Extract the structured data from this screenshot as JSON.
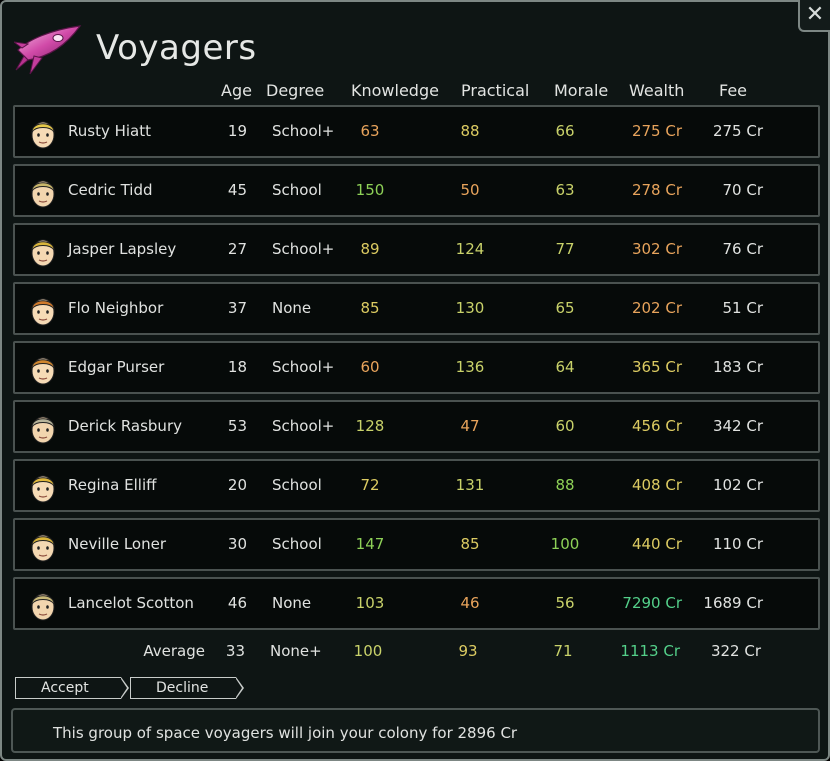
{
  "window": {
    "title": "Voyagers",
    "close_label": "✕"
  },
  "colors": {
    "text": "#e0e2e0",
    "bright_green": "#8ed157",
    "yellow_green": "#c9d26a",
    "yellow": "#dccb62",
    "orange": "#e8a45c",
    "teal_green": "#54d08a"
  },
  "columns": {
    "age": "Age",
    "degree": "Degree",
    "knowledge": "Knowledge",
    "practical": "Practical",
    "morale": "Morale",
    "wealth": "Wealth",
    "fee": "Fee"
  },
  "voyagers": [
    {
      "name": "Rusty Hiatt",
      "age": "19",
      "degree": "School+",
      "knowledge": "63",
      "practical": "88",
      "morale": "66",
      "wealth": "275 Cr",
      "fee": "275 Cr",
      "knowledge_color": "#e8a45c",
      "practical_color": "#dccb62",
      "morale_color": "#c9d26a",
      "wealth_color": "#e8a45c",
      "hair": "#e6c94a",
      "skin": "#f6dbb6"
    },
    {
      "name": "Cedric Tidd",
      "age": "45",
      "degree": "School",
      "knowledge": "150",
      "practical": "50",
      "morale": "63",
      "wealth": "278 Cr",
      "fee": "70 Cr",
      "knowledge_color": "#8ed157",
      "practical_color": "#e8a45c",
      "morale_color": "#c9d26a",
      "wealth_color": "#e8a45c",
      "hair": "#c8b66a",
      "skin": "#f2d5ae"
    },
    {
      "name": "Jasper Lapsley",
      "age": "27",
      "degree": "School+",
      "knowledge": "89",
      "practical": "124",
      "morale": "77",
      "wealth": "302 Cr",
      "fee": "76 Cr",
      "knowledge_color": "#dccb62",
      "practical_color": "#c9d26a",
      "morale_color": "#c9d26a",
      "wealth_color": "#e8a45c",
      "hair": "#d8b43a",
      "skin": "#f4d8b2"
    },
    {
      "name": "Flo Neighbor",
      "age": "37",
      "degree": "None",
      "knowledge": "85",
      "practical": "130",
      "morale": "65",
      "wealth": "202 Cr",
      "fee": "51 Cr",
      "knowledge_color": "#dccb62",
      "practical_color": "#c9d26a",
      "morale_color": "#c9d26a",
      "wealth_color": "#e8a45c",
      "hair": "#d07a2a",
      "skin": "#f6dbb6"
    },
    {
      "name": "Edgar Purser",
      "age": "18",
      "degree": "School+",
      "knowledge": "60",
      "practical": "136",
      "morale": "64",
      "wealth": "365 Cr",
      "fee": "183 Cr",
      "knowledge_color": "#e8a45c",
      "practical_color": "#c9d26a",
      "morale_color": "#c9d26a",
      "wealth_color": "#dccb62",
      "hair": "#d0862e",
      "skin": "#f6dbb6"
    },
    {
      "name": "Derick Rasbury",
      "age": "53",
      "degree": "School+",
      "knowledge": "128",
      "practical": "47",
      "morale": "60",
      "wealth": "456 Cr",
      "fee": "342 Cr",
      "knowledge_color": "#c9d26a",
      "practical_color": "#e8a45c",
      "morale_color": "#c9d26a",
      "wealth_color": "#dccb62",
      "hair": "#b8b49a",
      "skin": "#f2d5ae"
    },
    {
      "name": "Regina Elliff",
      "age": "20",
      "degree": "School",
      "knowledge": "72",
      "practical": "131",
      "morale": "88",
      "wealth": "408 Cr",
      "fee": "102 Cr",
      "knowledge_color": "#dccb62",
      "practical_color": "#c9d26a",
      "morale_color": "#8ed157",
      "wealth_color": "#dccb62",
      "hair": "#e0b83c",
      "skin": "#f6dbb6"
    },
    {
      "name": "Neville Loner",
      "age": "30",
      "degree": "School",
      "knowledge": "147",
      "practical": "85",
      "morale": "100",
      "wealth": "440 Cr",
      "fee": "110 Cr",
      "knowledge_color": "#8ed157",
      "practical_color": "#dccb62",
      "morale_color": "#8ed157",
      "wealth_color": "#dccb62",
      "hair": "#d8b43a",
      "skin": "#f4d8b2"
    },
    {
      "name": "Lancelot Scotton",
      "age": "46",
      "degree": "None",
      "knowledge": "103",
      "practical": "46",
      "morale": "56",
      "wealth": "7290 Cr",
      "fee": "1689 Cr",
      "knowledge_color": "#c9d26a",
      "practical_color": "#e8a45c",
      "morale_color": "#c9d26a",
      "wealth_color": "#54d08a",
      "hair": "#c8b878",
      "skin": "#f2d5ae"
    }
  ],
  "average": {
    "label": "Average",
    "age": "33",
    "degree": "None+",
    "knowledge": "100",
    "practical": "93",
    "morale": "71",
    "wealth": "1113 Cr",
    "fee": "322 Cr",
    "knowledge_color": "#c9d26a",
    "practical_color": "#dccb62",
    "morale_color": "#c9d26a",
    "wealth_color": "#54d08a"
  },
  "buttons": {
    "accept": "Accept",
    "decline": "Decline"
  },
  "status": {
    "message": "This group of space voyagers will join your colony for 2896 Cr"
  }
}
